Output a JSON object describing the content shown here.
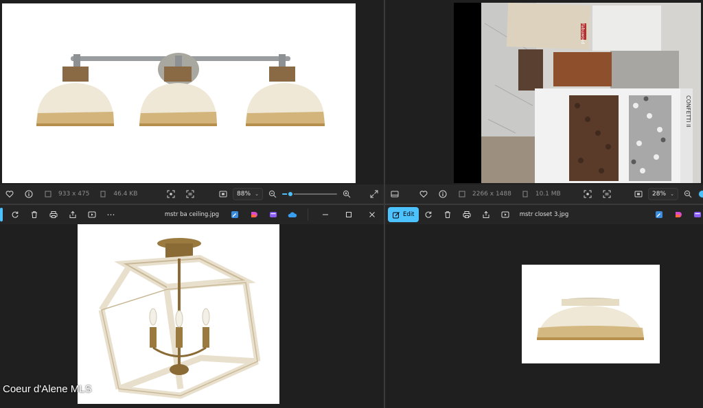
{
  "top_left": {
    "dimensions": "933 x 475",
    "file_size": "46.4 KB",
    "zoom": "88%",
    "zoom_slider_value": 0.15
  },
  "top_right": {
    "dimensions": "2266 x 1488",
    "file_size": "10.1 MB",
    "zoom": "28%",
    "sample_board_text": {
      "brand": "Fabuwood",
      "mosaic_label": "CONFETTI II"
    }
  },
  "bottom_left": {
    "filename": "mstr ba ceiling.jpg"
  },
  "bottom_right": {
    "edit_label": "Edit",
    "filename": "mstr closet 3.jpg"
  },
  "watermark": "Coeur d'Alene MLS",
  "icons": {
    "favorite": "heart-icon",
    "info": "info-icon",
    "dimensions": "dimensions-icon",
    "file": "file-icon",
    "ocr": "scan-text-icon",
    "visual_search": "visual-search-icon",
    "actual_size": "actual-size-icon",
    "zoom_out": "zoom-out-icon",
    "zoom_in": "zoom-in-icon",
    "expand": "expand-icon",
    "rotate": "rotate-icon",
    "delete": "trash-icon",
    "print": "print-icon",
    "share": "share-icon",
    "slideshow": "slideshow-icon",
    "more": "more-icon",
    "minimize": "minimize-icon",
    "maximize": "maximize-icon",
    "close": "close-icon",
    "onedrive": "onedrive-icon"
  },
  "colors": {
    "accent": "#4cc2ff",
    "background": "#202020"
  }
}
